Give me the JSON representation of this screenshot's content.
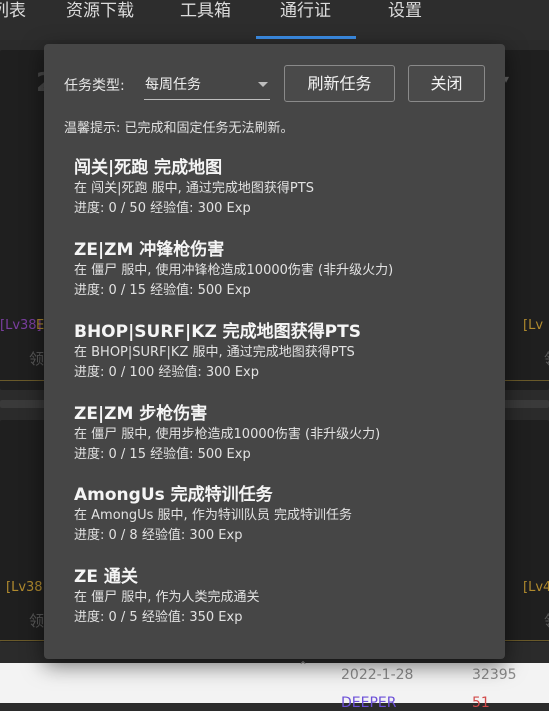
{
  "nav": {
    "items": [
      "列表",
      "资源下载",
      "工具箱",
      "通行证",
      "设置"
    ],
    "active": "通行证"
  },
  "background": {
    "big_digit": "2",
    "lvl_left_1": "[Lv38]",
    "lvl_left_1_tail": "E",
    "lvl_right_1": "[Lv",
    "claim_left_1": "领",
    "claim_right_1": "领",
    "lvl_left_2": "[Lv38",
    "lvl_right_2": "[Lv4",
    "claim_left_2": "领",
    "claim_right_2": "领",
    "row_date": "2022-1-28",
    "row_points": "32395",
    "row_name": "DEEPER",
    "row_score": "51"
  },
  "modal": {
    "type_label": "任务类型:",
    "type_value": "每周任务",
    "refresh_label": "刷新任务",
    "close_label": "关闭",
    "hint": "温馨提示: 已完成和固定任务无法刷新。",
    "tasks": [
      {
        "title": "闯关|死跑 完成地图",
        "desc": "在 闯关|死跑 服中, 通过完成地图获得PTS",
        "progress": "进度: 0 / 50 经验值: 300 Exp"
      },
      {
        "title": "ZE|ZM 冲锋枪伤害",
        "desc": "在 僵尸 服中, 使用冲锋枪造成10000伤害 (非升级火力)",
        "progress": "进度: 0 / 15 经验值: 500 Exp"
      },
      {
        "title": "BHOP|SURF|KZ 完成地图获得PTS",
        "desc": "在 BHOP|SURF|KZ 服中, 通过完成地图获得PTS",
        "progress": "进度: 0 / 100 经验值: 300 Exp"
      },
      {
        "title": "ZE|ZM 步枪伤害",
        "desc": "在 僵尸 服中, 使用步枪造成10000伤害 (非升级火力)",
        "progress": "进度: 0 / 15 经验值: 500 Exp"
      },
      {
        "title": "AmongUs 完成特训任务",
        "desc": "在 AmongUs 服中, 作为特训队员 完成特训任务",
        "progress": "进度: 0 / 8 经验值: 300 Exp"
      },
      {
        "title": "ZE 通关",
        "desc": "在 僵尸 服中, 作为人类完成通关",
        "progress": "进度: 0 / 5 经验值: 350 Exp"
      }
    ]
  },
  "colors": {
    "nav_active_underline": "#3c8ee6",
    "modal_background": "#464646",
    "background_level_purple": "#7b3fa0",
    "background_level_gold": "#b08a2e"
  }
}
